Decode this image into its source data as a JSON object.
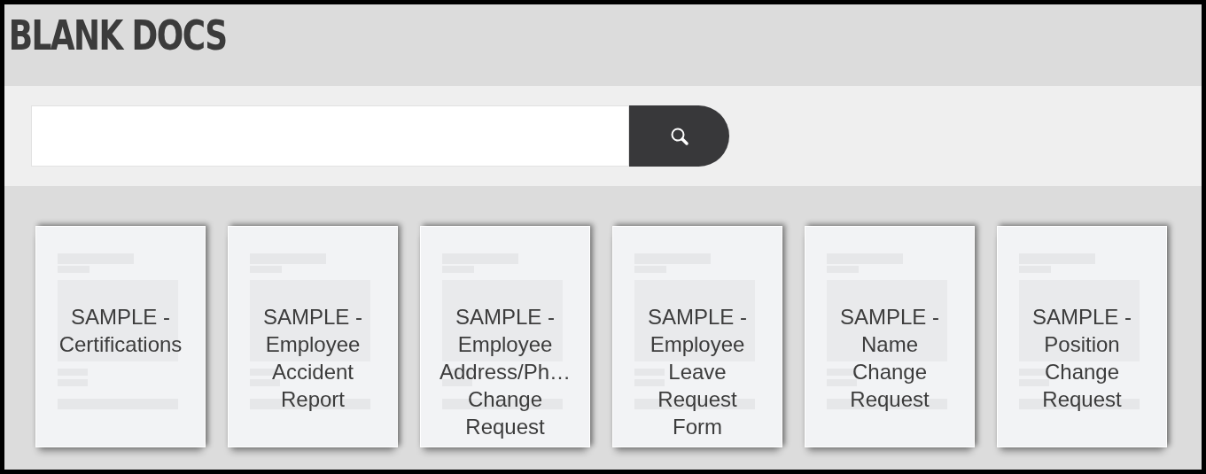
{
  "header": {
    "title": "BLANK DOCS"
  },
  "documents": [
    {
      "title": "SAMPLE - Certifications"
    },
    {
      "title": "SAMPLE - Employee Accident Report"
    },
    {
      "title": "SAMPLE - Employee Address/Ph… Change Request"
    },
    {
      "title": "SAMPLE - Employee Leave Request Form"
    },
    {
      "title": "SAMPLE - Name Change Request"
    },
    {
      "title": "SAMPLE - Position Change Request"
    }
  ]
}
